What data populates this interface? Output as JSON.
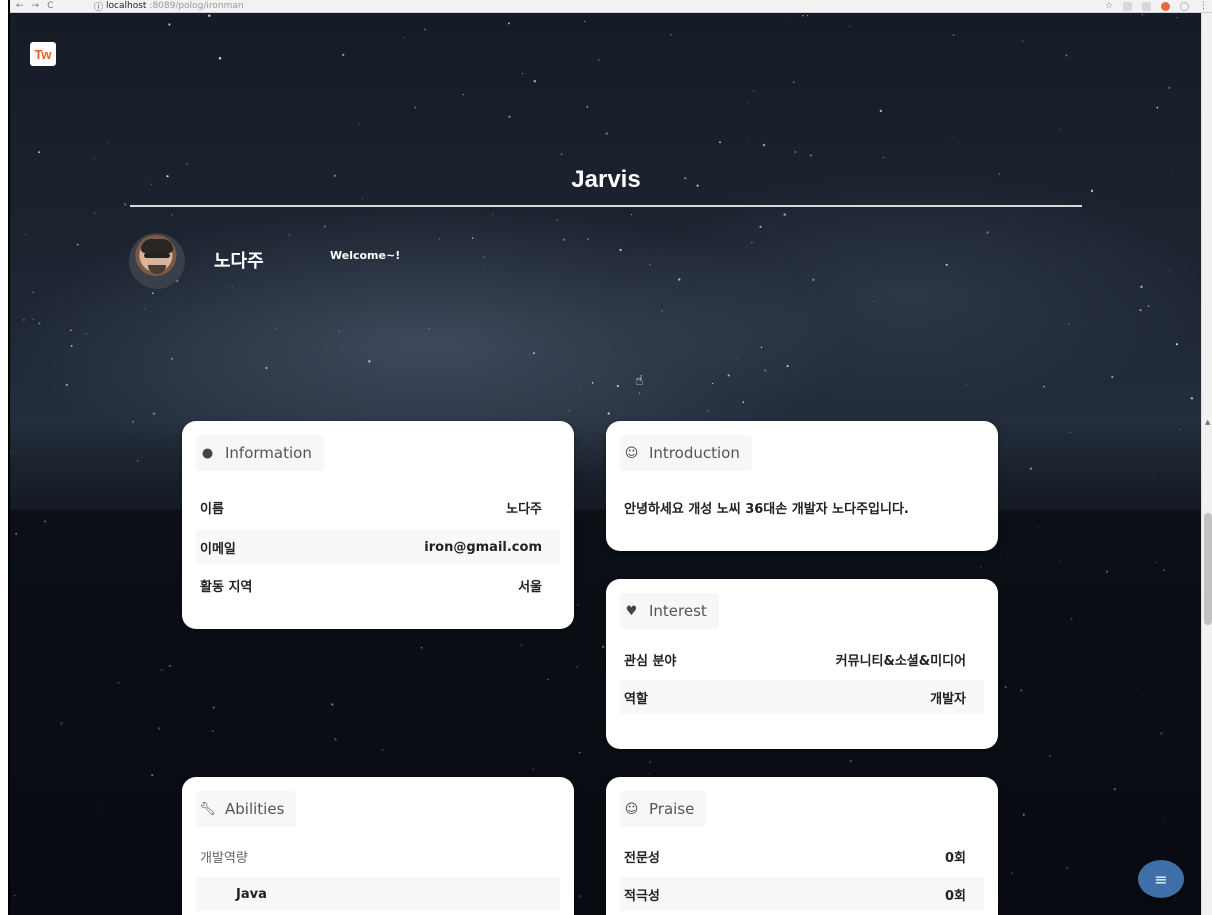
{
  "browser": {
    "nav_icons": [
      "←",
      "→",
      "C"
    ],
    "url_host": "localhost",
    "url_path": ":8089/polog/ironman"
  },
  "site": {
    "logo_text": "Tw"
  },
  "profile": {
    "title": "Jarvis",
    "user_name": "노다주",
    "greeting": "Welcome~!"
  },
  "information": {
    "heading": "Information",
    "icon": "info-icon",
    "rows": [
      {
        "key": "이름",
        "value": "노다주"
      },
      {
        "key": "이메일",
        "value": "iron@gmail.com"
      },
      {
        "key": "활동 지역",
        "value": "서울"
      }
    ]
  },
  "introduction": {
    "heading": "Introduction",
    "icon": "smile-icon",
    "text": "안녕하세요 개성 노씨 36대손 개발자 노다주입니다."
  },
  "interest": {
    "heading": "Interest",
    "icon": "heart-icon",
    "rows": [
      {
        "key": "관심 분야",
        "value": "커뮤니티&소셜&미디어"
      },
      {
        "key": "역할",
        "value": "개발자"
      }
    ]
  },
  "abilities": {
    "heading": "Abilities",
    "icon": "wrench-icon",
    "category": "개발역량",
    "items": [
      "Java"
    ]
  },
  "praise": {
    "heading": "Praise",
    "icon": "smiley-icon",
    "rows": [
      {
        "key": "전문성",
        "value": "0회"
      },
      {
        "key": "적극성",
        "value": "0회"
      }
    ]
  },
  "fab": {
    "icon": "menu-icon"
  },
  "colors": {
    "accent": "#3f6fa8",
    "logo": "#e8622b"
  }
}
